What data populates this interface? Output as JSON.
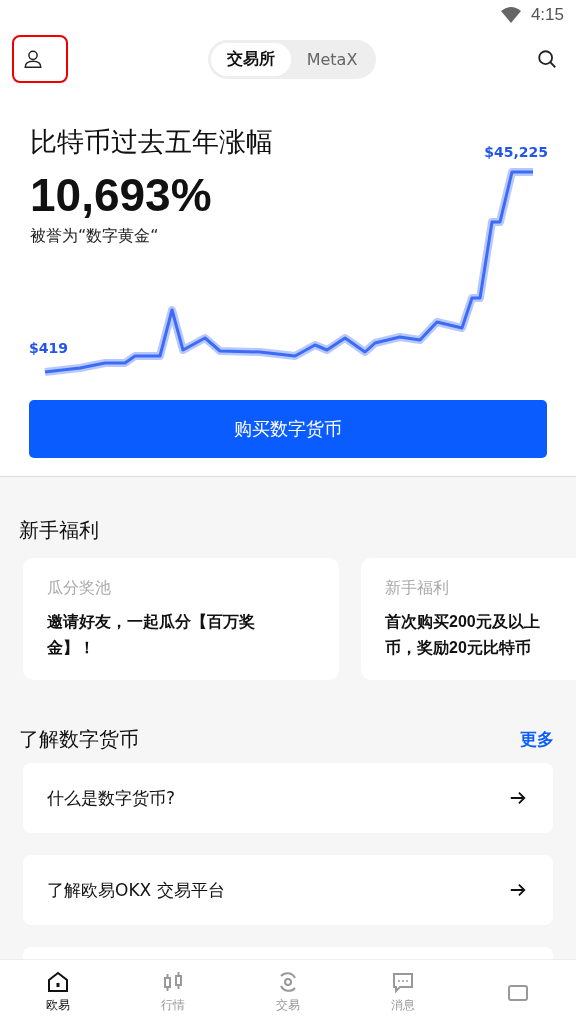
{
  "status_bar": {
    "time": "4:15"
  },
  "header": {
    "tabs": [
      {
        "label": "交易所",
        "selected": true
      },
      {
        "label": "MetaX",
        "selected": false
      }
    ]
  },
  "hero": {
    "title": "比特币过去五年涨幅",
    "value": "10,693%",
    "subtitle": "被誉为“数字黄金“",
    "chart_high": "$45,225",
    "chart_low": "$419",
    "button": "购买数字货币"
  },
  "newbie": {
    "title": "新手福利",
    "cards": [
      {
        "tag": "瓜分奖池",
        "lines": [
          "邀请好友，一起瓜分【百万奖",
          "金】！"
        ]
      },
      {
        "tag": "新手福利",
        "lines": [
          "首次购买200元及以上",
          "币，奖励20元比特币"
        ]
      }
    ]
  },
  "learn": {
    "title": "了解数字货币",
    "more": "更多",
    "items": [
      {
        "text": "什么是数字货币?"
      },
      {
        "text": "了解欧易OKX 交易平台"
      }
    ]
  },
  "bottom_nav": [
    {
      "label": "欧易",
      "kind": "home",
      "selected": true
    },
    {
      "label": "行情",
      "kind": "market",
      "selected": false
    },
    {
      "label": "交易",
      "kind": "trade",
      "selected": false
    },
    {
      "label": "消息",
      "kind": "message",
      "selected": false
    },
    {
      "kind": "wallet",
      "selected": false
    }
  ]
}
